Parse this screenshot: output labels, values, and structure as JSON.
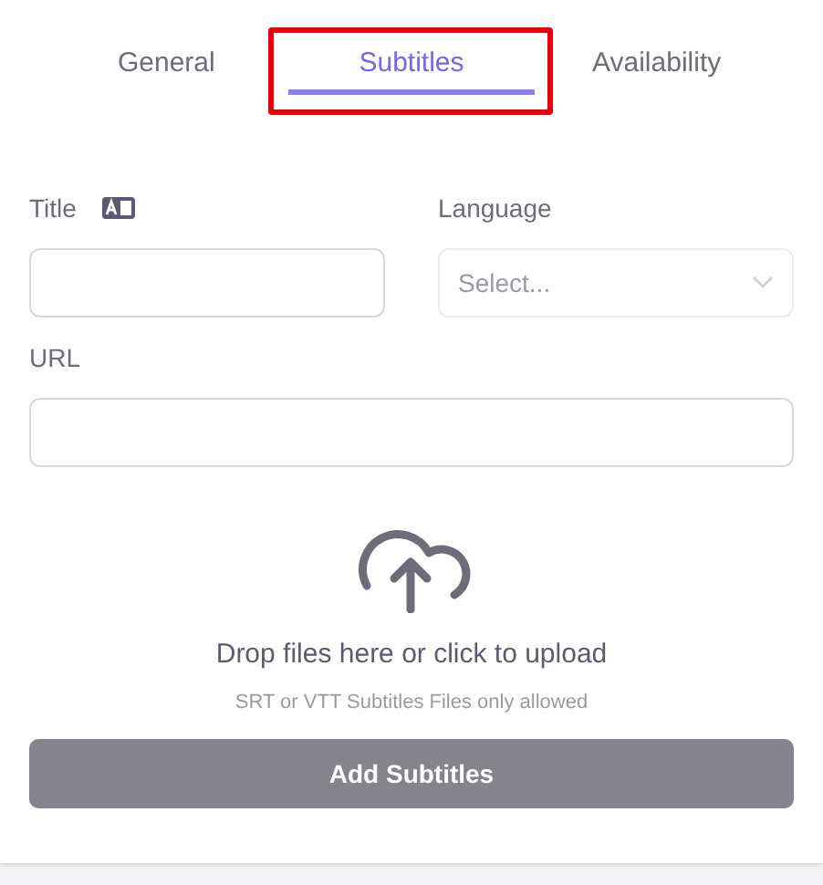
{
  "tabs": [
    {
      "label": "General",
      "selected": false
    },
    {
      "label": "Subtitles",
      "selected": true
    },
    {
      "label": "Availability",
      "selected": false
    }
  ],
  "form": {
    "title_label": "Title",
    "language_label": "Language",
    "language_placeholder": "Select...",
    "url_label": "URL"
  },
  "upload": {
    "prompt": "Drop files here or click to upload",
    "hint": "SRT or VTT Subtitles Files only allowed"
  },
  "submit_button": {
    "label": "Add Subtitles",
    "disabled": true
  }
}
